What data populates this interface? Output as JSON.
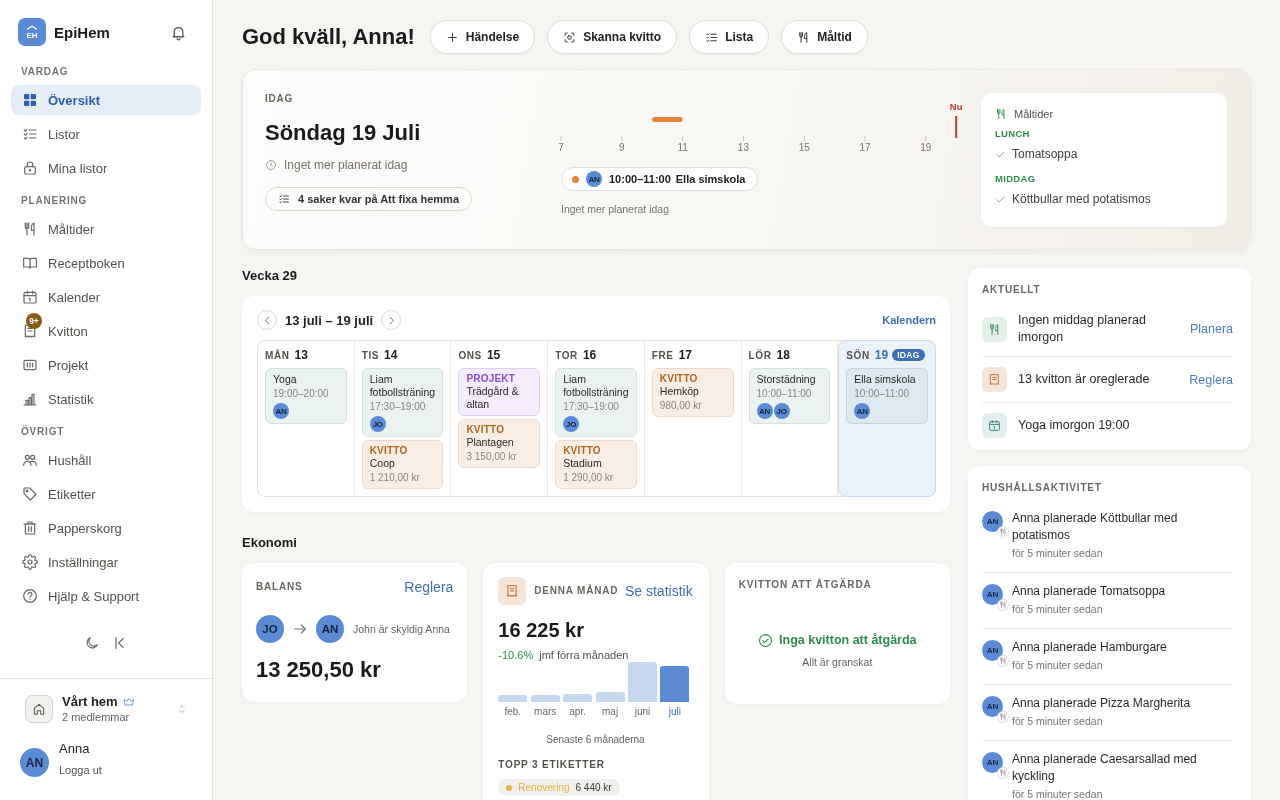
{
  "sidebar": {
    "logo_text": "EH",
    "app_name": "EpiHem",
    "sections": [
      {
        "title": "VARDAG",
        "items": [
          {
            "label": "Översikt",
            "selected": true
          },
          {
            "label": "Listor",
            "selected": false
          },
          {
            "label": "Mina listor",
            "selected": false
          }
        ]
      },
      {
        "title": "PLANERING",
        "items": [
          {
            "label": "Måltider",
            "selected": false
          },
          {
            "label": "Receptboken",
            "selected": false
          },
          {
            "label": "Kalender",
            "selected": false
          },
          {
            "label": "Kvitton",
            "selected": false,
            "badge": "9+"
          },
          {
            "label": "Projekt",
            "selected": false
          },
          {
            "label": "Statistik",
            "selected": false
          }
        ]
      },
      {
        "title": "ÖVRIGT",
        "items": [
          {
            "label": "Hushåll",
            "selected": false
          },
          {
            "label": "Etiketter",
            "selected": false
          },
          {
            "label": "Papperskorg",
            "selected": false
          },
          {
            "label": "Inställningar",
            "selected": false
          },
          {
            "label": "Hjälp & Support",
            "selected": false
          }
        ]
      }
    ],
    "household": {
      "name": "Vårt hem",
      "members": "2 medlemmar"
    },
    "user": {
      "initials": "AN",
      "name": "Anna",
      "action": "Logga ut"
    }
  },
  "header": {
    "greeting": "God kväll, Anna!",
    "actions": [
      {
        "label": "Händelse"
      },
      {
        "label": "Skanna kvitto"
      },
      {
        "label": "Lista"
      },
      {
        "label": "Måltid"
      }
    ]
  },
  "today": {
    "eyebrow": "IDAG",
    "date": "Söndag 19 Juli",
    "status": "Inget mer planerat idag",
    "todo": "4 saker kvar på Att fixa hemma",
    "timeline": {
      "hours": [
        "7",
        "9",
        "11",
        "13",
        "15",
        "17",
        "19"
      ],
      "now_label": "Nu",
      "event": {
        "color": "#e8833a",
        "avatar": "AN",
        "time": "10:00–11:00",
        "title": "Ella simskola"
      },
      "note": "Inget mer planerat idag"
    },
    "meals": {
      "title": "Måltider",
      "entries": [
        {
          "label": "LUNCH",
          "dish": "Tomatsoppa"
        },
        {
          "label": "MIDDAG",
          "dish": "Köttbullar med potatismos"
        }
      ]
    }
  },
  "week": {
    "title": "Vecka 29",
    "range": "13 juli – 19 juli",
    "link": "Kalendern",
    "days": [
      {
        "weekday": "MÅN",
        "date": "13",
        "today": false,
        "events": [
          {
            "kind": "event",
            "title": "Yoga",
            "time": "19:00–20:00",
            "avatars": [
              "AN"
            ]
          }
        ]
      },
      {
        "weekday": "TIS",
        "date": "14",
        "today": false,
        "events": [
          {
            "kind": "event",
            "title": "Liam fotbollsträning",
            "time": "17:30–19:00",
            "avatars": [
              "JO"
            ]
          },
          {
            "kind": "receipt",
            "tag": "KVITTO",
            "title": "Coop",
            "amount": "1 210,00 kr"
          }
        ]
      },
      {
        "weekday": "ONS",
        "date": "15",
        "today": false,
        "events": [
          {
            "kind": "project",
            "tag": "PROJEKT",
            "title": "Trädgård & altan"
          },
          {
            "kind": "receipt",
            "tag": "KVITTO",
            "title": "Plantagen",
            "amount": "3 150,00 kr"
          }
        ]
      },
      {
        "weekday": "TOR",
        "date": "16",
        "today": false,
        "events": [
          {
            "kind": "event",
            "title": "Liam fotbollsträning",
            "time": "17:30–19:00",
            "avatars": [
              "JO"
            ]
          },
          {
            "kind": "receipt",
            "tag": "KVITTO",
            "title": "Stadium",
            "amount": "1 290,00 kr"
          }
        ]
      },
      {
        "weekday": "FRE",
        "date": "17",
        "today": false,
        "events": [
          {
            "kind": "receipt",
            "tag": "KVITTO",
            "title": "Hemköp",
            "amount": "980,00 kr"
          }
        ]
      },
      {
        "weekday": "LÖR",
        "date": "18",
        "today": false,
        "events": [
          {
            "kind": "event",
            "title": "Storstädning",
            "time": "10:00–11:00",
            "avatars": [
              "AN",
              "JO"
            ]
          }
        ]
      },
      {
        "weekday": "SÖN",
        "date": "19",
        "today": true,
        "badge": "IDAG",
        "events": [
          {
            "kind": "event",
            "title": "Ella simskola",
            "time": "10:00–11:00",
            "avatars": [
              "AN"
            ]
          }
        ]
      }
    ]
  },
  "economy": {
    "title": "Ekonomi",
    "balance": {
      "label": "BALANS",
      "link": "Reglera",
      "from": "JO",
      "to": "AN",
      "note": "John är skyldig Anna",
      "amount": "13 250,50 kr"
    },
    "month": {
      "label": "DENNA MÅNAD",
      "link": "Se statistik",
      "total": "16 225 kr",
      "change": "-10.6%",
      "change_note": "jmf förra månaden",
      "months": [
        {
          "label": "feb.",
          "selected": false
        },
        {
          "label": "mars",
          "selected": false
        },
        {
          "label": "apr.",
          "selected": false
        },
        {
          "label": "maj",
          "selected": false
        },
        {
          "label": "juni",
          "selected": false
        },
        {
          "label": "juli",
          "selected": true
        }
      ],
      "caption": "Senaste 6 månaderna",
      "tags_title": "TOPP 3 ETIKETTER",
      "tags": [
        {
          "name": "Renovering",
          "amount": "6 440 kr",
          "color": "#e6b23c"
        }
      ]
    },
    "receipts": {
      "label": "KVITTON ATT ÅTGÄRDA",
      "status": "Inga kvitton att åtgärda",
      "note": "Allt är granskat"
    }
  },
  "current": {
    "title": "AKTUELLT",
    "items": [
      {
        "kind": "meal",
        "text": "Ingen middag planerad imorgon",
        "action": "Planera"
      },
      {
        "kind": "receipt",
        "text": "13 kvitton är oreglerade",
        "action": "Reglera"
      },
      {
        "kind": "calendar",
        "text": "Yoga imorgon 19:00"
      }
    ]
  },
  "activity": {
    "title": "HUSHÅLLSAKTIVITET",
    "items": [
      {
        "avatar": "AN",
        "text": "Anna planerade Köttbullar med potatismos",
        "time": "för 5 minuter sedan"
      },
      {
        "avatar": "AN",
        "text": "Anna planerade Tomatsoppa",
        "time": "för 5 minuter sedan"
      },
      {
        "avatar": "AN",
        "text": "Anna planerade Hamburgare",
        "time": "för 5 minuter sedan"
      },
      {
        "avatar": "AN",
        "text": "Anna planerade Pizza Margherita",
        "time": "för 5 minuter sedan"
      },
      {
        "avatar": "AN",
        "text": "Anna planerade Caesarsallad med kyckling",
        "time": "för 5 minuter sedan"
      }
    ]
  }
}
